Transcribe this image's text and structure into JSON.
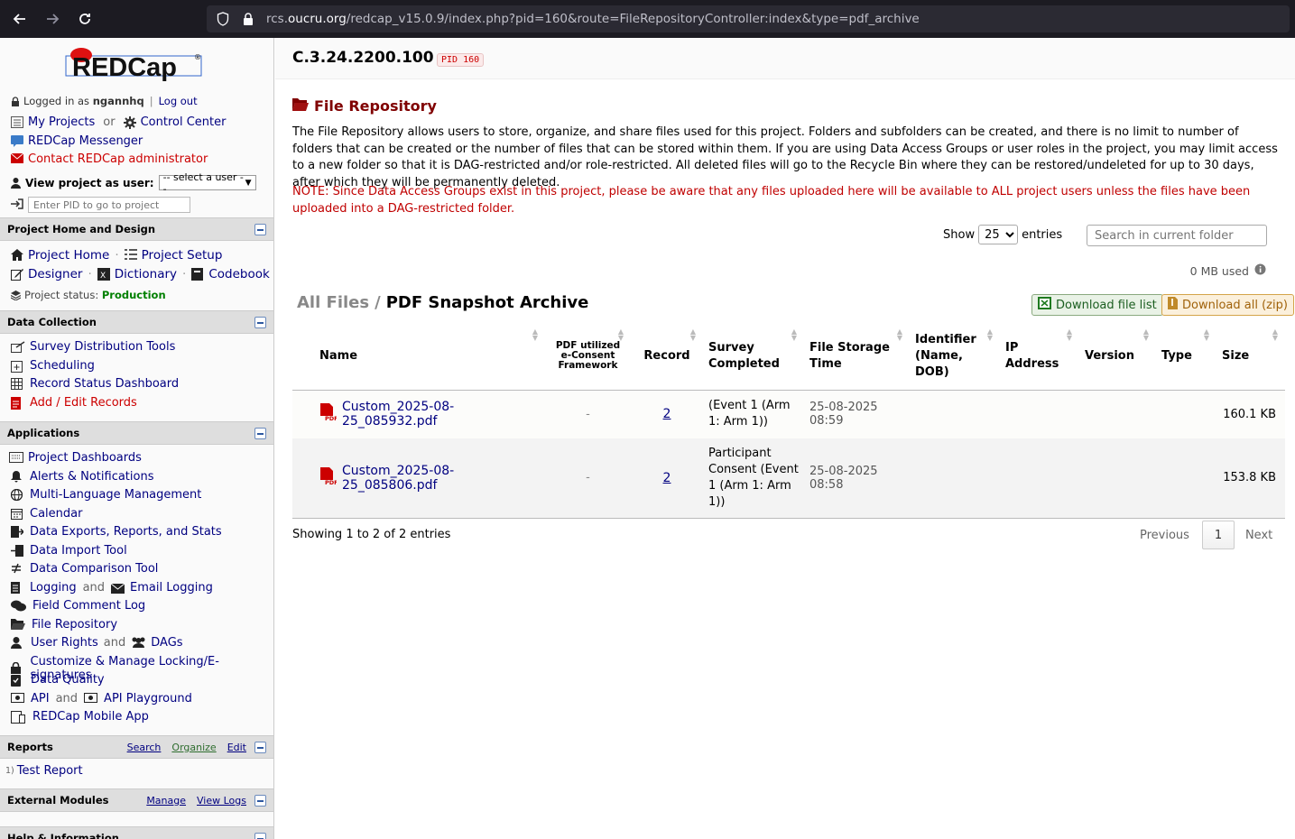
{
  "browser": {
    "url_prefix": "rcs.",
    "url_domain": "oucru.org",
    "url_rest": "/redcap_v15.0.9/index.php?pid=160&route=FileRepositoryController:index&type=pdf_archive"
  },
  "sidebar": {
    "logo_text": "REDCap",
    "logged_in_prefix": "Logged in as",
    "username": "ngannhq",
    "logout": "Log out",
    "my_projects": "My Projects",
    "or": "or",
    "control_center": "Control Center",
    "messenger": "REDCap Messenger",
    "contact_admin": "Contact REDCap administrator",
    "view_as_label": "View project as user:",
    "view_as_value": "-- select a user --",
    "pid_placeholder": "Enter PID to go to project",
    "sections": {
      "home_design": {
        "title": "Project Home and Design",
        "project_home": "Project Home",
        "project_setup": "Project Setup",
        "designer": "Designer",
        "dictionary": "Dictionary",
        "codebook": "Codebook",
        "status_label": "Project status:",
        "status_value": "Production"
      },
      "data_collection": {
        "title": "Data Collection",
        "items": [
          "Survey Distribution Tools",
          "Scheduling",
          "Record Status Dashboard",
          "Add / Edit Records"
        ]
      },
      "applications": {
        "title": "Applications",
        "project_dashboards": "Project Dashboards",
        "alerts": "Alerts & Notifications",
        "mlm": "Multi-Language Management",
        "calendar": "Calendar",
        "exports": "Data Exports, Reports, and Stats",
        "import": "Data Import Tool",
        "comparison": "Data Comparison Tool",
        "logging": "Logging",
        "and": "and",
        "email_logging": "Email Logging",
        "field_comment": "Field Comment Log",
        "file_repo": "File Repository",
        "user_rights": "User Rights",
        "dags": "DAGs",
        "locking": "Customize & Manage Locking/E-signatures",
        "data_quality": "Data Quality",
        "api": "API",
        "api_playground": "API Playground",
        "mobile": "REDCap Mobile App"
      },
      "reports": {
        "title": "Reports",
        "search": "Search",
        "organize": "Organize",
        "edit": "Edit",
        "report_num": "1)",
        "report_name": "Test Report"
      },
      "external_modules": {
        "title": "External Modules",
        "manage": "Manage",
        "view_logs": "View Logs"
      },
      "help": {
        "title": "Help & Information"
      }
    }
  },
  "main": {
    "project_title": "C.3.24.2200.100",
    "pid_badge": "PID 160",
    "page_title": "File Repository",
    "description": "The File Repository allows users to store, organize, and share files used for this project. Folders and subfolders can be created, and there is no limit to number of folders that can be created or the number of files that can be stored within them. If you are using Data Access Groups or user roles in the project, you may limit access to a new folder so that it is DAG-restricted and/or role-restricted. All deleted files will go to the Recycle Bin where they can be restored/undeleted for up to 30 days, after which they will be permanently deleted.",
    "note": "NOTE: Since Data Access Groups exist in this project, please be aware that any files uploaded here will be available to ALL project users unless the files have been uploaded into a DAG-restricted folder.",
    "show_label": "Show",
    "show_value": "25",
    "entries_label": "entries",
    "search_placeholder": "Search in current folder",
    "mb_used": "0 MB used",
    "breadcrumb_root": "All Files",
    "breadcrumb_sep": "/",
    "breadcrumb_current": "PDF Snapshot Archive",
    "download_list": "Download file list",
    "download_all": "Download all (zip)",
    "columns": {
      "name": "Name",
      "econsent": "PDF utilized e-Consent Framework",
      "record": "Record",
      "survey": "Survey Completed",
      "storage_time": "File Storage Time",
      "identifier": "Identifier (Name, DOB)",
      "ip": "IP Address",
      "version": "Version",
      "type": "Type",
      "size": "Size"
    },
    "rows": [
      {
        "name": "Custom_2025-08-25_085932.pdf",
        "econsent": "-",
        "record": "2",
        "survey": "(Event 1 (Arm 1: Arm 1))",
        "time": "25-08-2025 08:59",
        "size": "160.1 KB"
      },
      {
        "name": "Custom_2025-08-25_085806.pdf",
        "econsent": "-",
        "record": "2",
        "survey": "Participant Consent (Event 1 (Arm 1: Arm 1))",
        "time": "25-08-2025 08:58",
        "size": "153.8 KB"
      }
    ],
    "showing": "Showing 1 to 2 of 2 entries",
    "pager": {
      "previous": "Previous",
      "current": "1",
      "next": "Next"
    }
  },
  "colors": {
    "sidebar_link": "#000080",
    "title_red": "#800000",
    "note_red": "#c00000",
    "status_green": "#008000"
  }
}
